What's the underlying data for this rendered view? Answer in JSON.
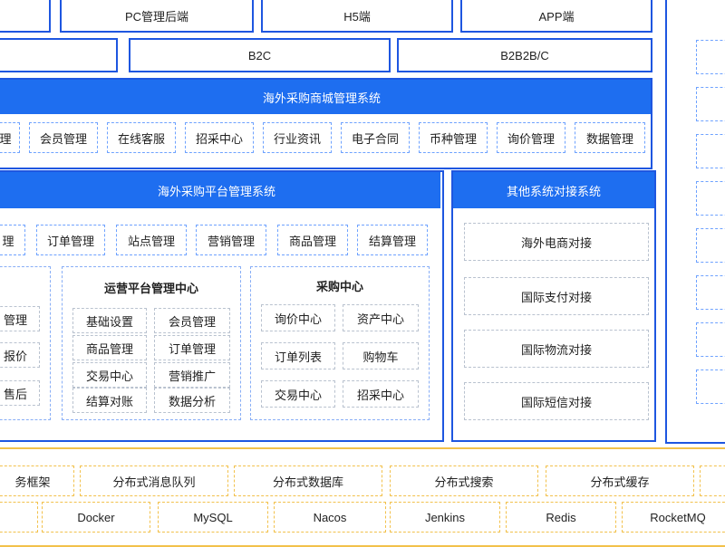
{
  "top": {
    "row1": [
      "PC管理后端",
      "H5端",
      "APP端"
    ],
    "row2": [
      "B2C",
      "B2B2B/C"
    ]
  },
  "mall": {
    "title": "海外采购商城管理系统",
    "items": [
      "理",
      "会员管理",
      "在线客服",
      "招采中心",
      "行业资讯",
      "电子合同",
      "币种管理",
      "询价管理",
      "数据管理"
    ]
  },
  "platform": {
    "title": "海外采购平台管理系统",
    "items": [
      "理",
      "订单管理",
      "站点管理",
      "营销管理",
      "商品管理",
      "结算管理"
    ],
    "left_partial": {
      "title": "​",
      "items": [
        "管理",
        "报价",
        "售后"
      ]
    },
    "ops": {
      "title": "运营平台管理中心",
      "items": [
        "基础设置",
        "会员管理",
        "商品管理",
        "订单管理",
        "交易中心",
        "营销推广",
        "结算对账",
        "数据分析"
      ]
    },
    "purchase": {
      "title": "采购中心",
      "items": [
        "询价中心",
        "资产中心",
        "订单列表",
        "购物车",
        "交易中心",
        "招采中心"
      ]
    }
  },
  "other": {
    "title": "其他系统对接系统",
    "items": [
      "海外电商对接",
      "国际支付对接",
      "国际物流对接",
      "国际短信对接"
    ]
  },
  "infra": {
    "row1": [
      "务框架",
      "分布式消息队列",
      "分布式数据库",
      "分布式搜索",
      "分布式缓存"
    ],
    "row2": [
      "Docker",
      "MySQL",
      "Nacos",
      "Jenkins",
      "Redis",
      "RocketMQ"
    ]
  },
  "colors": {
    "primary_blue": "#1e6ef0",
    "border_blue": "#1e56e0",
    "infra_yellow": "#f2c14b"
  }
}
